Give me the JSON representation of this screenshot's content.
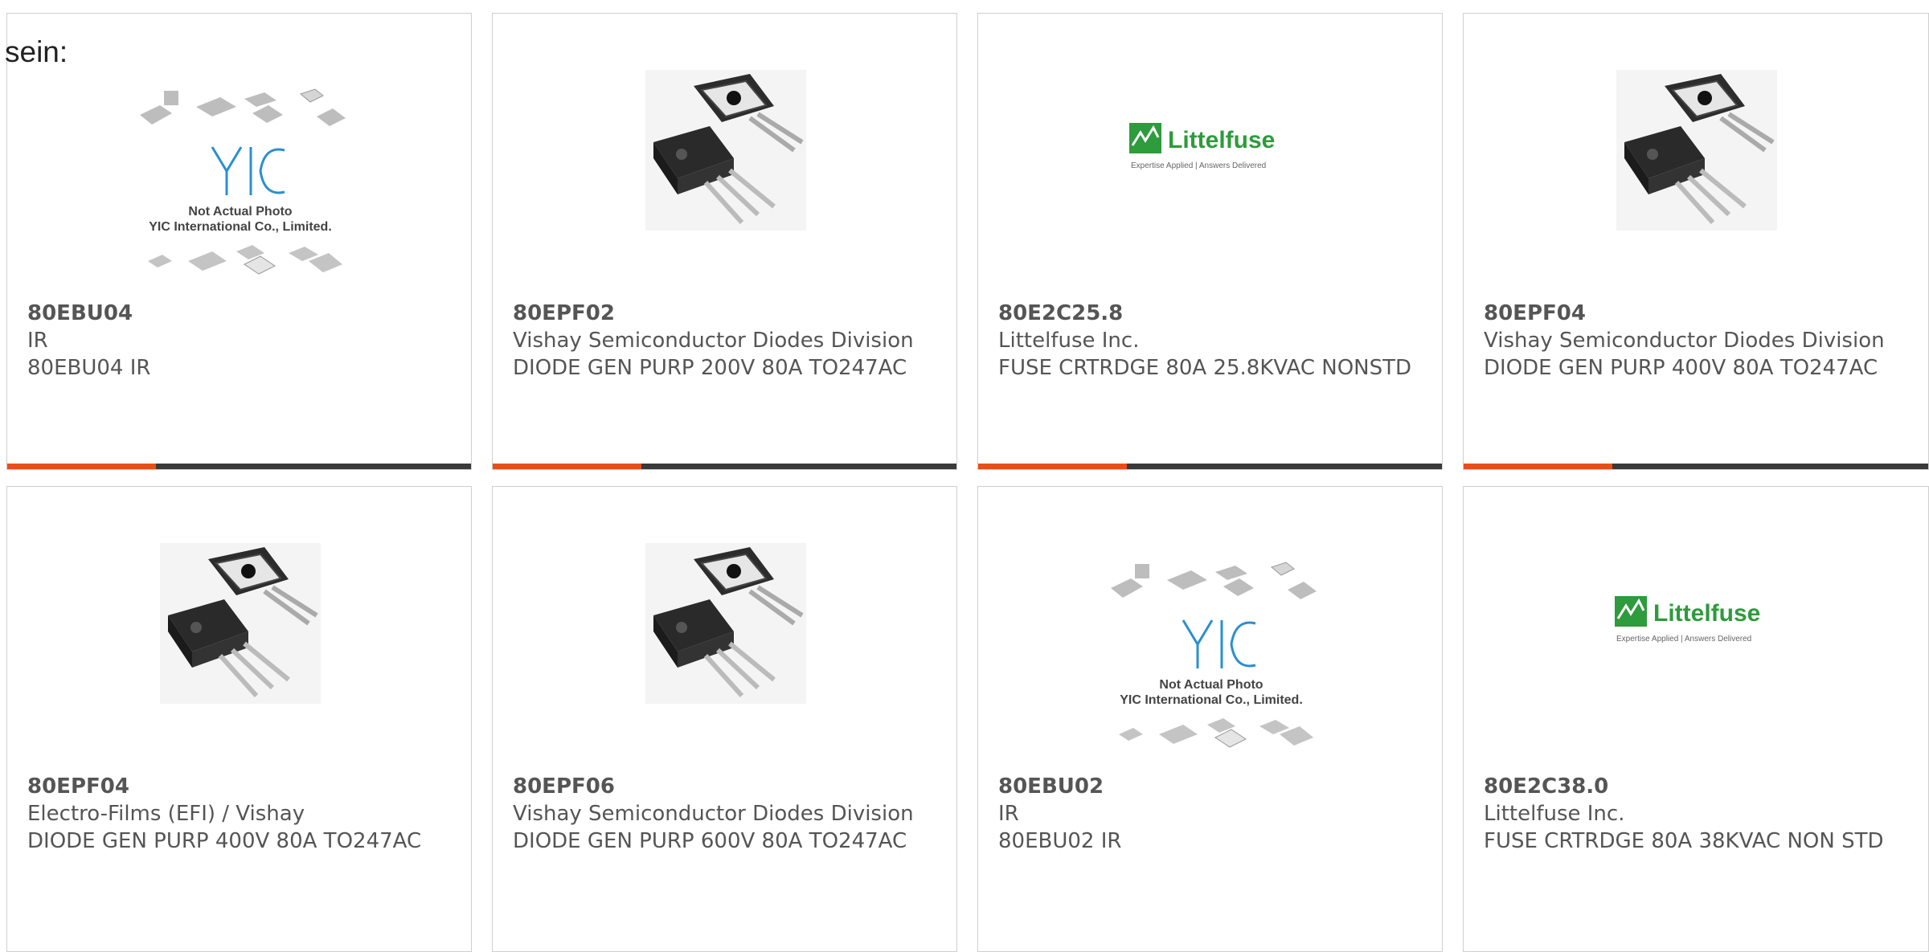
{
  "intro_text": "sein:",
  "colors": {
    "accent": "#e84e1b",
    "bar": "#3a3a3a",
    "littelfuse_green": "#2e9b3c"
  },
  "cards": [
    {
      "part": "80EBU04",
      "maker": "IR",
      "desc": "80EBU04 IR",
      "image": "yic-generic-icon"
    },
    {
      "part": "80EPF02",
      "maker": "Vishay Semiconductor Diodes Division",
      "desc": "DIODE GEN PURP 200V 80A TO247AC",
      "image": "to247-icon"
    },
    {
      "part": "80E2C25.8",
      "maker": "Littelfuse Inc.",
      "desc": "FUSE CRTRDGE 80A 25.8KVAC NONSTD",
      "image": "littelfuse-logo"
    },
    {
      "part": "80EPF04",
      "maker": "Vishay Semiconductor Diodes Division",
      "desc": "DIODE GEN PURP 400V 80A TO247AC",
      "image": "to247-icon"
    },
    {
      "part": "80EPF04",
      "maker": "Electro-Films (EFI) / Vishay",
      "desc": "DIODE GEN PURP 400V 80A TO247AC",
      "image": "to247-icon"
    },
    {
      "part": "80EPF06",
      "maker": "Vishay Semiconductor Diodes Division",
      "desc": "DIODE GEN PURP 600V 80A TO247AC",
      "image": "to247-icon"
    },
    {
      "part": "80EBU02",
      "maker": "IR",
      "desc": "80EBU02 IR",
      "image": "yic-generic-icon"
    },
    {
      "part": "80E2C38.0",
      "maker": "Littelfuse Inc.",
      "desc": "FUSE CRTRDGE 80A 38KVAC NON STD",
      "image": "littelfuse-logo"
    }
  ],
  "yic_placeholder": {
    "line1": "Not Actual Photo",
    "line2": "YIC International Co., Limited.",
    "logo": "YIC"
  },
  "littelfuse": {
    "name": "Littelfuse",
    "tagline": "Expertise Applied | Answers Delivered"
  }
}
